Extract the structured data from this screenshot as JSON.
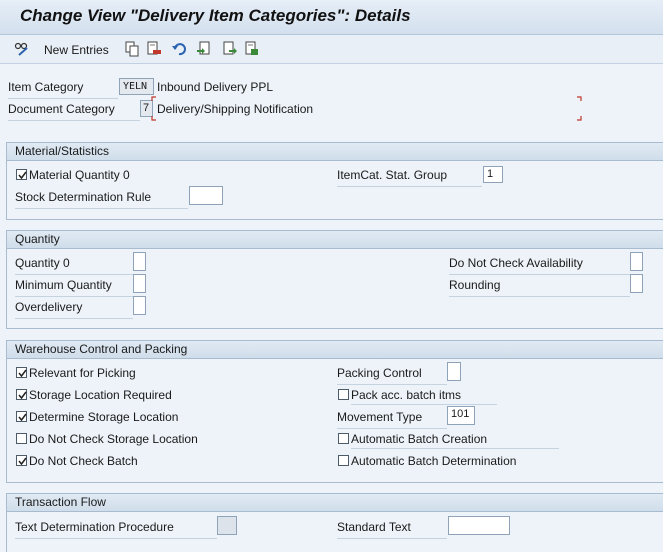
{
  "window": {
    "title": "Change View \"Delivery Item Categories\": Details"
  },
  "toolbar": {
    "new_entries_label": "New Entries",
    "icons": [
      "edit-glasses-icon",
      "copy-icon",
      "delete-icon",
      "undo-icon",
      "select-all-icon",
      "previous-entry-icon",
      "next-entry-icon"
    ]
  },
  "header": {
    "item_category": {
      "label": "Item Category",
      "value": "YELN",
      "description": "Inbound Delivery PPL"
    },
    "document_category": {
      "label": "Document Category",
      "value": "7",
      "description": "Delivery/Shipping Notification"
    }
  },
  "material_statistics": {
    "title": "Material/Statistics",
    "material_quantity_0": {
      "label": "Material Quantity 0",
      "checked": true
    },
    "itemcat_stat_group": {
      "label": "ItemCat. Stat. Group",
      "value": "1"
    },
    "stock_determination_rule": {
      "label": "Stock Determination Rule",
      "value": ""
    }
  },
  "quantity": {
    "title": "Quantity",
    "quantity_0": {
      "label": "Quantity 0",
      "value": ""
    },
    "minimum_quantity": {
      "label": "Minimum Quantity",
      "value": ""
    },
    "overdelivery": {
      "label": "Overdelivery",
      "value": ""
    },
    "do_not_check_availability": {
      "label": "Do Not Check Availability",
      "value": ""
    },
    "rounding": {
      "label": "Rounding",
      "value": ""
    }
  },
  "warehouse": {
    "title": "Warehouse Control and Packing",
    "relevant_for_picking": {
      "label": "Relevant for Picking",
      "checked": true
    },
    "storage_location_required": {
      "label": "Storage Location Required",
      "checked": true
    },
    "determine_storage_location": {
      "label": "Determine Storage Location",
      "checked": true
    },
    "do_not_check_storage_location": {
      "label": "Do Not Check Storage Location",
      "checked": false
    },
    "do_not_check_batch": {
      "label": "Do Not Check Batch",
      "checked": true
    },
    "packing_control": {
      "label": "Packing Control",
      "value": ""
    },
    "pack_acc_batch_itms": {
      "label": "Pack acc. batch itms",
      "checked": false
    },
    "movement_type": {
      "label": "Movement Type",
      "value": "101"
    },
    "automatic_batch_creation": {
      "label": "Automatic Batch Creation",
      "checked": false
    },
    "automatic_batch_determination": {
      "label": "Automatic Batch Determination",
      "checked": false
    }
  },
  "transaction_flow": {
    "title": "Transaction Flow",
    "text_determination_procedure": {
      "label": "Text Determination Procedure",
      "value": ""
    },
    "standard_text": {
      "label": "Standard Text",
      "value": ""
    }
  }
}
